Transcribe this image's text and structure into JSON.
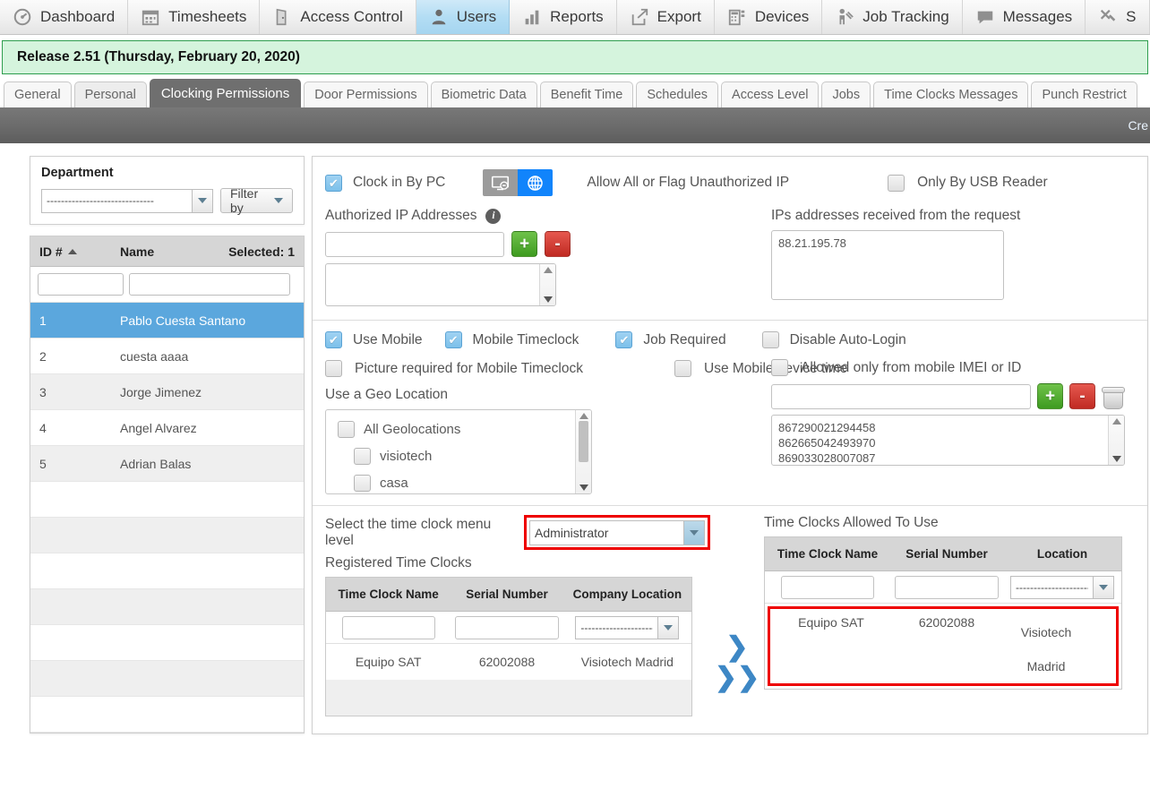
{
  "topnav": {
    "items": [
      {
        "label": "Dashboard",
        "icon": "dashboard-icon",
        "active": false
      },
      {
        "label": "Timesheets",
        "icon": "calendar-icon",
        "active": false
      },
      {
        "label": "Access Control",
        "icon": "door-icon",
        "active": false
      },
      {
        "label": "Users",
        "icon": "user-icon",
        "active": true
      },
      {
        "label": "Reports",
        "icon": "bar-chart-icon",
        "active": false
      },
      {
        "label": "Export",
        "icon": "export-icon",
        "active": false
      },
      {
        "label": "Devices",
        "icon": "device-icon",
        "active": false
      },
      {
        "label": "Job Tracking",
        "icon": "job-tracking-icon",
        "active": false
      },
      {
        "label": "Messages",
        "icon": "speech-bubble-icon",
        "active": false
      },
      {
        "label": "S",
        "icon": "tools-icon",
        "active": false
      }
    ]
  },
  "release": {
    "text": "Release 2.51 (Thursday, February 20, 2020)"
  },
  "tabs": {
    "items": [
      {
        "label": "General",
        "active": false,
        "muted": false
      },
      {
        "label": "Personal",
        "active": false,
        "muted": true
      },
      {
        "label": "Clocking Permissions",
        "active": true,
        "muted": false
      },
      {
        "label": "Door Permissions",
        "active": false,
        "muted": false
      },
      {
        "label": "Biometric Data",
        "active": false,
        "muted": false
      },
      {
        "label": "Benefit Time",
        "active": false,
        "muted": false
      },
      {
        "label": "Schedules",
        "active": false,
        "muted": false
      },
      {
        "label": "Access Level",
        "active": false,
        "muted": false
      },
      {
        "label": "Jobs",
        "active": false,
        "muted": false
      },
      {
        "label": "Time Clocks Messages",
        "active": false,
        "muted": false
      },
      {
        "label": "Punch Restrict",
        "active": false,
        "muted": false
      }
    ]
  },
  "toolbar": {
    "partial_label": "Cre"
  },
  "sidebar": {
    "department": {
      "title": "Department",
      "select_value": "------------------------------",
      "filter_label": "Filter by"
    },
    "userlist": {
      "col_id": "ID #",
      "col_name": "Name",
      "selected_label": "Selected: 1",
      "filter_id_value": "",
      "filter_name_value": "",
      "rows": [
        {
          "id": "1",
          "name": "Pablo Cuesta Santano",
          "selected": true
        },
        {
          "id": "2",
          "name": "cuesta aaaa",
          "selected": false
        },
        {
          "id": "3",
          "name": "Jorge Jimenez",
          "selected": false
        },
        {
          "id": "4",
          "name": "Angel Alvarez",
          "selected": false
        },
        {
          "id": "5",
          "name": "Adrian Balas",
          "selected": false
        }
      ],
      "empty_rows": 7
    }
  },
  "main": {
    "pc_section": {
      "clock_in_by_pc": {
        "label": "Clock in By PC",
        "checked": true
      },
      "toggle_left_icon": "monitor-icon",
      "toggle_right_icon": "globe-icon",
      "toggle_selected": "globe",
      "allow_all_label": "Allow All or Flag Unauthorized IP",
      "only_usb": {
        "label": "Only By USB Reader",
        "checked": false
      },
      "authorized_ip_label": "Authorized IP Addresses",
      "authorized_ip_value": "",
      "add_button": "+",
      "remove_button": "-",
      "received_ips_label": "IPs addresses received from the request",
      "received_ips_value": "88.21.195.78",
      "authorized_ip_list_value": ""
    },
    "mobile_section": {
      "use_mobile": {
        "label": "Use Mobile",
        "checked": true
      },
      "mobile_timeclock": {
        "label": "Mobile Timeclock",
        "checked": true
      },
      "job_required": {
        "label": "Job Required",
        "checked": true
      },
      "disable_auto_login": {
        "label": "Disable Auto-Login",
        "checked": false
      },
      "picture_required": {
        "label": "Picture required for Mobile Timeclock",
        "checked": false
      },
      "use_device_time": {
        "label": "Use Mobile device time",
        "checked": false
      },
      "geo_label": "Use a Geo Location",
      "geo_items": [
        {
          "label": "All Geolocations",
          "checked": false,
          "indent": false
        },
        {
          "label": "visiotech",
          "checked": false,
          "indent": true
        },
        {
          "label": "casa",
          "checked": false,
          "indent": true
        }
      ],
      "imei_checkbox": {
        "label": "Allowed only from mobile IMEI or ID",
        "checked": false
      },
      "imei_input_value": "",
      "imei_add": "+",
      "imei_remove": "-",
      "imei_trash_icon": "trash-icon",
      "imei_list": [
        "867290021294458",
        "862665042493970",
        "869033028007087"
      ]
    },
    "clocks_section": {
      "menu_level_label": "Select the time clock menu level",
      "menu_level_value": "Administrator",
      "registered_label": "Registered Time Clocks",
      "registered_table": {
        "columns": [
          "Time Clock Name",
          "Serial Number",
          "Company Location"
        ],
        "filters": [
          "",
          "",
          "------------------------"
        ],
        "rows": [
          {
            "name": "Equipo SAT",
            "serial": "62002088",
            "location": "Visiotech Madrid"
          }
        ]
      },
      "move_one_icon": "chevron-right-icon",
      "move_all_icon": "chevron-double-right-icon",
      "allowed_label": "Time Clocks Allowed To Use",
      "allowed_table": {
        "columns": [
          "Time Clock Name",
          "Serial Number",
          "Location"
        ],
        "filters": [
          "",
          "",
          "------------------------"
        ],
        "rows": [
          {
            "name": "Equipo SAT",
            "serial": "62002088",
            "location": "Visiotech Madrid"
          }
        ]
      }
    }
  },
  "colors": {
    "accent_blue": "#1184fb",
    "selected_row": "#5ba7dd",
    "release_bg": "#d5f4dd",
    "release_border": "#2e9e4e",
    "highlight_red": "#ee0000",
    "active_tab": "#6f6f6f"
  }
}
